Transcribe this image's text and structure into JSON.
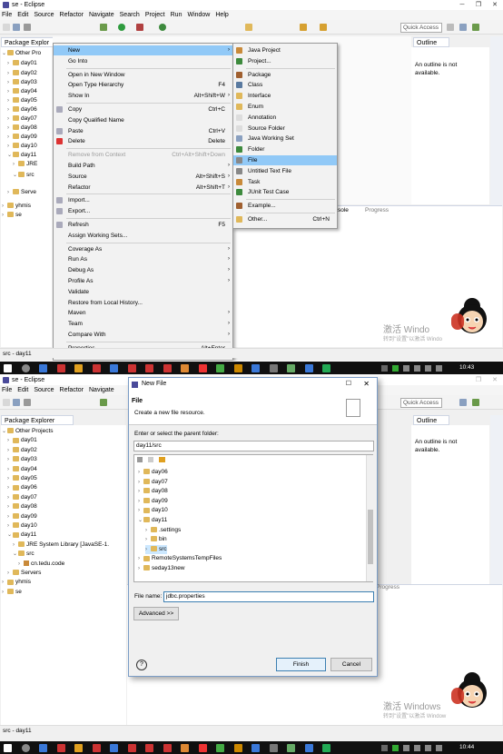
{
  "top": {
    "title": "se - Eclipse",
    "menu": [
      "File",
      "Edit",
      "Source",
      "Refactor",
      "Navigate",
      "Search",
      "Project",
      "Run",
      "Window",
      "Help"
    ],
    "quick_access": "Quick Access",
    "package_explorer_tab": "Package Explor",
    "outline_tab": "Outline",
    "outline_msg": "An outline is not available.",
    "tree": [
      "Other Pro",
      "day01",
      "day02",
      "day03",
      "day04",
      "day05",
      "day06",
      "day07",
      "day08",
      "day09",
      "day10",
      "day11",
      "JRE",
      "src",
      "Serve",
      "yhmis",
      "se"
    ],
    "context_menu": [
      {
        "label": "New",
        "acc": "",
        "arrow": true,
        "hl": true
      },
      {
        "label": "Go Into",
        "acc": ""
      },
      {
        "sep": true
      },
      {
        "label": "Open in New Window",
        "acc": ""
      },
      {
        "label": "Open Type Hierarchy",
        "acc": "F4"
      },
      {
        "label": "Show In",
        "acc": "Alt+Shift+W",
        "arrow": true
      },
      {
        "sep": true
      },
      {
        "label": "Copy",
        "acc": "Ctrl+C"
      },
      {
        "label": "Copy Qualified Name",
        "acc": ""
      },
      {
        "label": "Paste",
        "acc": "Ctrl+V"
      },
      {
        "label": "Delete",
        "acc": "Delete"
      },
      {
        "sep": true
      },
      {
        "label": "Remove from Context",
        "acc": "Ctrl+Alt+Shift+Down",
        "dis": true
      },
      {
        "label": "Build Path",
        "acc": "",
        "arrow": true
      },
      {
        "label": "Source",
        "acc": "Alt+Shift+S",
        "arrow": true
      },
      {
        "label": "Refactor",
        "acc": "Alt+Shift+T",
        "arrow": true
      },
      {
        "sep": true
      },
      {
        "label": "Import...",
        "acc": ""
      },
      {
        "label": "Export...",
        "acc": ""
      },
      {
        "sep": true
      },
      {
        "label": "Refresh",
        "acc": "F5"
      },
      {
        "label": "Assign Working Sets...",
        "acc": ""
      },
      {
        "sep": true
      },
      {
        "label": "Coverage As",
        "acc": "",
        "arrow": true
      },
      {
        "label": "Run As",
        "acc": "",
        "arrow": true
      },
      {
        "label": "Debug As",
        "acc": "",
        "arrow": true
      },
      {
        "label": "Profile As",
        "acc": "",
        "arrow": true
      },
      {
        "label": "Validate",
        "acc": ""
      },
      {
        "label": "Restore from Local History...",
        "acc": ""
      },
      {
        "label": "Maven",
        "acc": "",
        "arrow": true
      },
      {
        "label": "Team",
        "acc": "",
        "arrow": true
      },
      {
        "label": "Compare With",
        "acc": "",
        "arrow": true
      },
      {
        "sep": true
      },
      {
        "label": "Properties",
        "acc": "Alt+Enter"
      }
    ],
    "submenu": [
      {
        "label": "Java Project"
      },
      {
        "label": "Project..."
      },
      {
        "sep": true
      },
      {
        "label": "Package"
      },
      {
        "label": "Class"
      },
      {
        "label": "Interface"
      },
      {
        "label": "Enum"
      },
      {
        "label": "Annotation"
      },
      {
        "label": "Source Folder"
      },
      {
        "label": "Java Working Set"
      },
      {
        "label": "Folder"
      },
      {
        "label": "File",
        "hl": true
      },
      {
        "label": "Untitled Text File"
      },
      {
        "label": "Task"
      },
      {
        "label": "JUnit Test Case"
      },
      {
        "sep": true
      },
      {
        "label": "Example..."
      },
      {
        "sep": true
      },
      {
        "label": "Other...",
        "acc": "Ctrl+N"
      }
    ],
    "console_tab": "sole",
    "progress_tab": "Progress",
    "status": "src - day11",
    "watermark": "激活 Windo",
    "watermark_sub": "转到\"设置\"以激活 Windo",
    "time": "10:43"
  },
  "bottom": {
    "title": "se - Eclipse",
    "menu": [
      "File",
      "Edit",
      "Source",
      "Refactor",
      "Navigate"
    ],
    "quick_access": "Quick Access",
    "package_explorer_tab": "Package Explorer",
    "outline_tab": "Outline",
    "outline_msg": "An outline is not available.",
    "tree": [
      "Other Projects",
      "day01",
      "day02",
      "day03",
      "day04",
      "day05",
      "day06",
      "day07",
      "day08",
      "day09",
      "day10",
      "day11",
      "JRE System Library [JavaSE-1.",
      "src",
      "cn.tedu.code",
      "Servers",
      "yhmis",
      "se"
    ],
    "progress_tab": "Progress",
    "status": "src - day11",
    "watermark": "激活 Windows",
    "watermark_sub": "转到\"设置\"以激活 Window",
    "time": "10:44",
    "dialog": {
      "title": "New File",
      "heading": "File",
      "subtitle": "Create a new file resource.",
      "parent_label": "Enter or select the parent folder:",
      "parent_value": "day11/src",
      "folders": [
        "day06",
        "day07",
        "day08",
        "day09",
        "day10",
        "day11",
        ".settings",
        "bin",
        "src",
        "RemoteSystemsTempFiles",
        "seday13new"
      ],
      "file_name_label": "File name:",
      "file_name_value": "jdbc.properties",
      "advanced": "Advanced >>",
      "help": "?",
      "finish": "Finish",
      "cancel": "Cancel"
    }
  },
  "colors": {
    "highlight": "#91c9f7",
    "taskbar": "#101010",
    "accent": "#3c7fb1"
  }
}
